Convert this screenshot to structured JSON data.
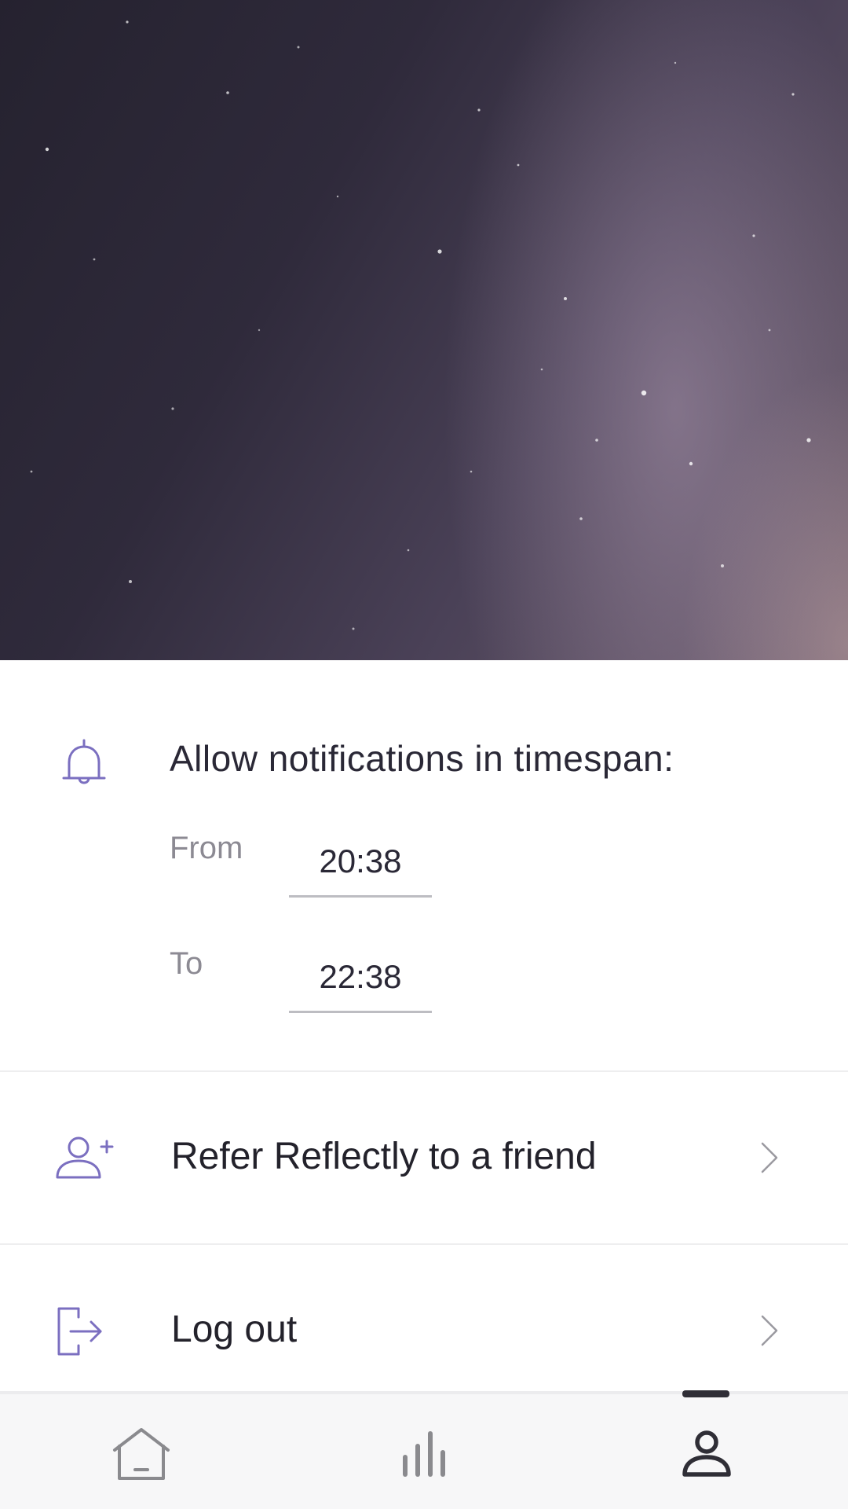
{
  "notifications": {
    "title": "Allow notifications in timespan:",
    "from_label": "From",
    "from_time": "20:38",
    "to_label": "To",
    "to_time": "22:38",
    "icon": "bell-icon"
  },
  "menu": {
    "refer": {
      "label": "Refer Reflectly to a friend",
      "icon": "add-user-icon"
    },
    "logout": {
      "label": "Log out",
      "icon": "logout-icon"
    }
  },
  "bottom_nav": {
    "items": [
      {
        "icon": "home-icon",
        "active": false
      },
      {
        "icon": "stats-icon",
        "active": false
      },
      {
        "icon": "profile-icon",
        "active": true
      }
    ]
  },
  "colors": {
    "accent": "#7b6fc0",
    "text": "#2a2836",
    "muted": "#8c8a93",
    "nav_icon": "#8a8a8e",
    "nav_active": "#2f2e36"
  }
}
